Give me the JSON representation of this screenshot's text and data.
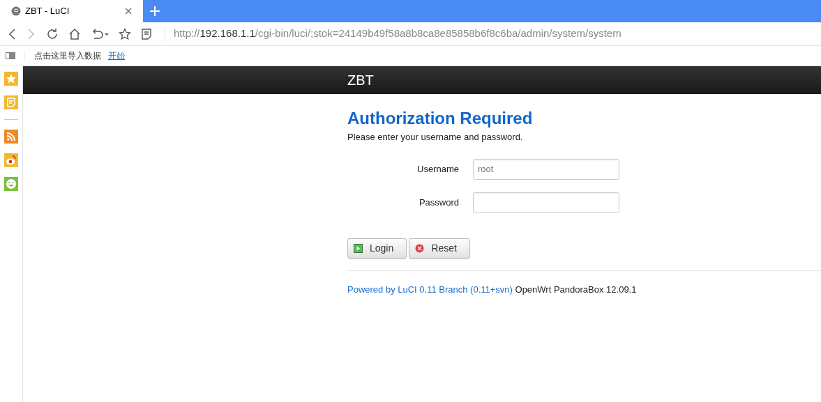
{
  "browser": {
    "tabs": [
      {
        "title": "ZBT - LuCI",
        "selected": true
      }
    ],
    "address": {
      "scheme": "http://",
      "host": "192.168.1.1",
      "path": "/cgi-bin/luci/;stok=24149b49f58a8b8ca8e85858b6f8c6ba/admin/system/system"
    },
    "bookmarks": {
      "hint": "点击这里导入数据",
      "link": "开始"
    },
    "sidebar": [
      {
        "kind": "star",
        "color": "#f5b731"
      },
      {
        "kind": "note",
        "color": "#f5b731"
      },
      {
        "kind": "divider"
      },
      {
        "kind": "rss",
        "color": "#f08a24"
      },
      {
        "kind": "weibo",
        "color": "#f5b731"
      },
      {
        "kind": "smile",
        "color": "#7cc03a"
      }
    ]
  },
  "page": {
    "brand": "ZBT",
    "heading": "Authorization Required",
    "intro": "Please enter your username and password.",
    "fields": [
      {
        "label": "Username",
        "value": "root",
        "kind": "text"
      },
      {
        "label": "Password",
        "kind": "password"
      }
    ],
    "buttons": [
      {
        "label": "Login",
        "kind": "login"
      },
      {
        "label": "Reset",
        "kind": "reset"
      }
    ],
    "footer": {
      "link": "Powered by LuCI 0.11 Branch (0.11+svn)",
      "text": "OpenWrt PandoraBox 12.09.1"
    }
  }
}
